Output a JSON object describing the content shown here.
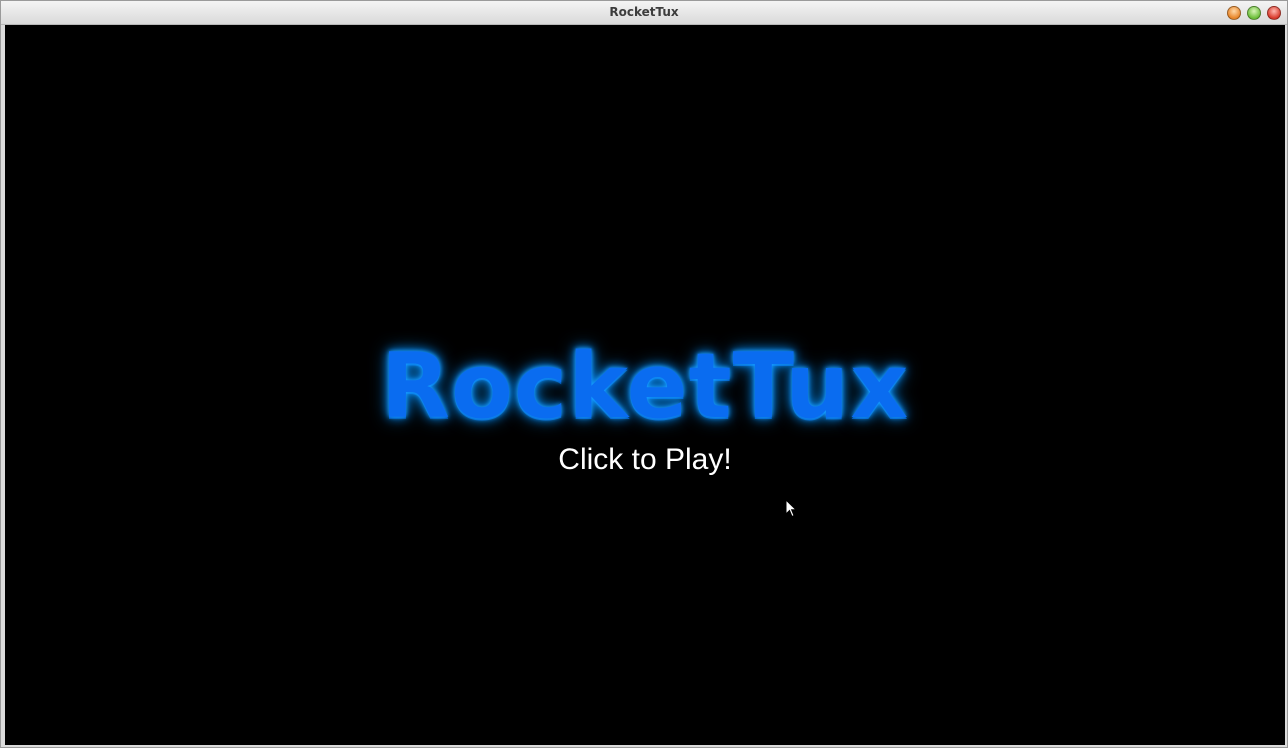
{
  "window": {
    "title": "RocketTux",
    "controls": {
      "minimize_icon": "minimize-icon",
      "maximize_icon": "maximize-icon",
      "close_icon": "close-icon"
    }
  },
  "game": {
    "logo_text": "RocketTux",
    "logo_color": "#0a6cf0",
    "glow_color": "#1aa0ff",
    "prompt": "Click to Play!"
  }
}
